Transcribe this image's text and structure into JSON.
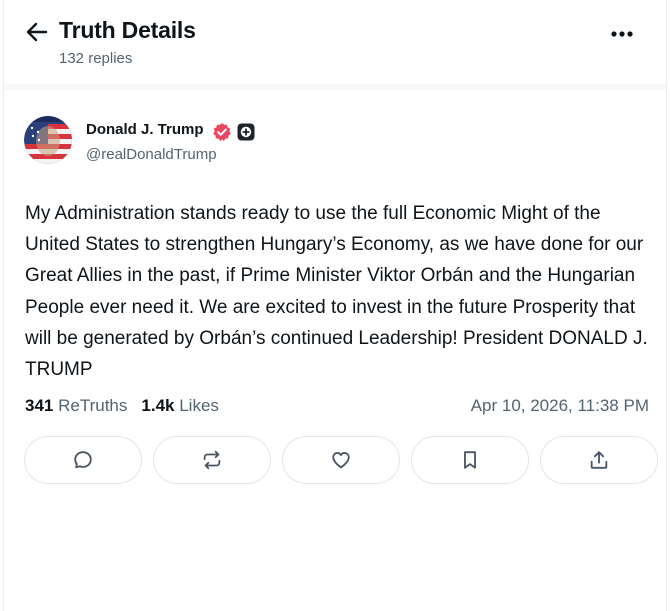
{
  "header": {
    "title": "Truth Details",
    "subtitle": "132 replies"
  },
  "post": {
    "author_name": "Donald J. Trump",
    "handle": "@realDonaldTrump",
    "body": "My Administration stands ready to use the full Economic Might of the United States to strengthen Hungary’s Economy, as we have done for our Great Allies in the past, if Prime Minister Viktor Orbán and the Hungarian People ever need it. We are excited to invest in the future Prosperity that will be generated by Orbán’s continued Leadership! President DONALD J. TRUMP",
    "retruths_count": "341",
    "retruths_label": "ReTruths",
    "likes_count": "1.4k",
    "likes_label": "Likes",
    "timestamp": "Apr 10, 2026, 11:38 PM"
  },
  "icons": {
    "back": "arrow-left-icon",
    "more": "more-horizontal-icon",
    "verified": "verified-badge-icon",
    "plus": "plus-badge-icon",
    "reply": "comment-icon",
    "retruth": "repost-icon",
    "like": "heart-icon",
    "bookmark": "bookmark-icon",
    "share": "share-icon"
  },
  "colors": {
    "verified": "#e8475f",
    "text_primary": "#0f1419",
    "text_secondary": "#536471"
  }
}
